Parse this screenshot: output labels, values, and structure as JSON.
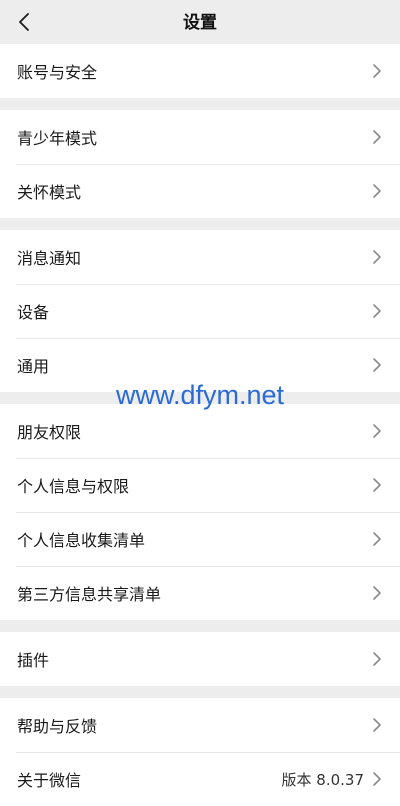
{
  "header": {
    "title": "设置",
    "back_icon": "chevron-left-icon"
  },
  "groups": [
    {
      "items": [
        {
          "label": "账号与安全",
          "value": ""
        }
      ]
    },
    {
      "items": [
        {
          "label": "青少年模式",
          "value": ""
        },
        {
          "label": "关怀模式",
          "value": ""
        }
      ]
    },
    {
      "items": [
        {
          "label": "消息通知",
          "value": ""
        },
        {
          "label": "设备",
          "value": ""
        },
        {
          "label": "通用",
          "value": ""
        }
      ]
    },
    {
      "items": [
        {
          "label": "朋友权限",
          "value": ""
        },
        {
          "label": "个人信息与权限",
          "value": ""
        },
        {
          "label": "个人信息收集清单",
          "value": ""
        },
        {
          "label": "第三方信息共享清单",
          "value": ""
        }
      ]
    },
    {
      "items": [
        {
          "label": "插件",
          "value": ""
        }
      ]
    },
    {
      "items": [
        {
          "label": "帮助与反馈",
          "value": ""
        },
        {
          "label": "关于微信",
          "value": "版本 8.0.37"
        }
      ]
    }
  ],
  "watermark": {
    "text": "www.dfym.net"
  },
  "colors": {
    "background": "#ededed",
    "card": "#ffffff",
    "watermark": "#2a6bd6"
  }
}
